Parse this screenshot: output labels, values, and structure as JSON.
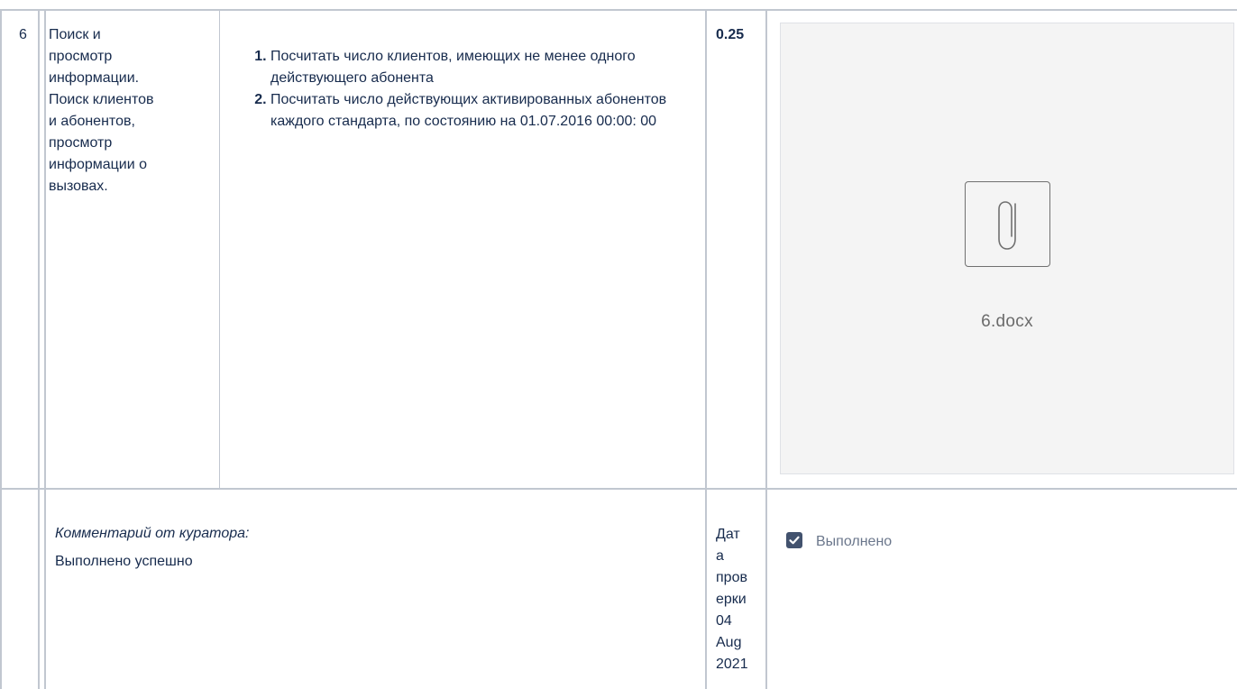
{
  "task": {
    "number": "6",
    "topic_lines": [
      "Поиск и",
      "просмотр",
      "информации.",
      "Поиск клиентов",
      "и абонентов,",
      "просмотр",
      "информации о",
      "вызовах."
    ],
    "steps": [
      "Посчитать число клиентов, имеющих не менее одного действующего абонента",
      "Посчитать число действующих активированных абонентов каждого стандарта, по состоянию на 01.07.2016 00:00: 00"
    ],
    "score": "0.25",
    "attachment": {
      "file_name": "6.docx",
      "icon": "paperclip-icon"
    }
  },
  "review": {
    "comment_label": "Комментарий от куратора:",
    "comment_text": "Выполнено успешно",
    "date_lines": [
      "Дат",
      "а",
      "пров",
      "ерки",
      "04",
      "Aug",
      "2021"
    ],
    "status": {
      "checked": true,
      "label": "Выполнено"
    }
  },
  "colors": {
    "border": "#c1c7d0",
    "panel_bg": "#f4f4f4",
    "checkbox": "#42526e",
    "status_text": "#6b778c"
  }
}
